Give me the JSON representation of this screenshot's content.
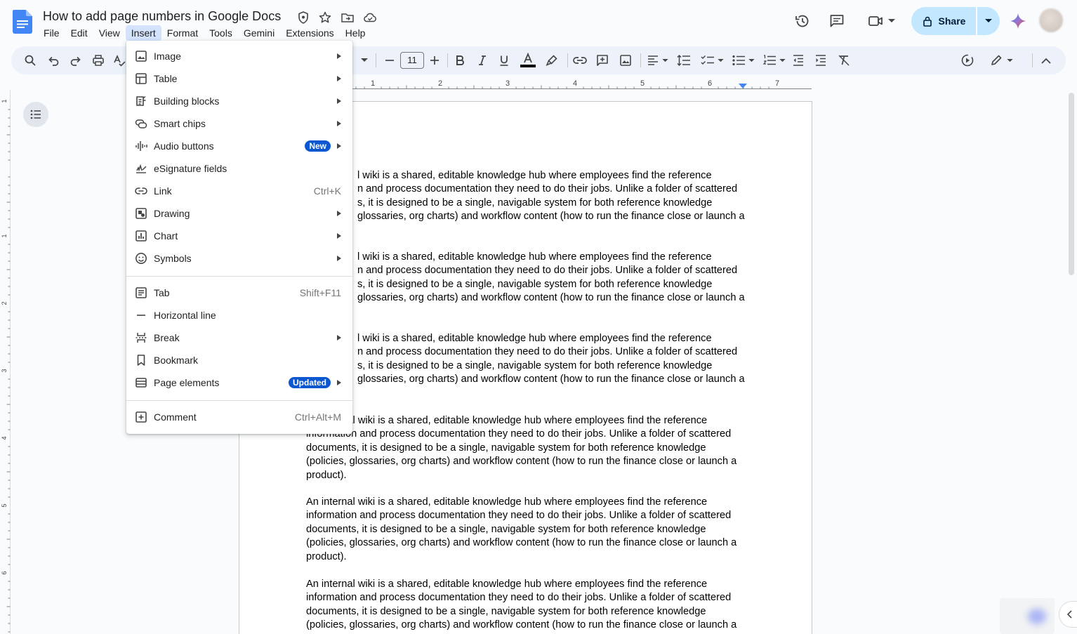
{
  "document": {
    "title": "How to add page numbers in Google Docs",
    "paragraph_first_lines": [
      "l wiki is a shared, editable knowledge hub where employees find the reference",
      "n and process documentation they need to do their jobs. Unlike a folder of scattered",
      "s, it is designed to be a single, navigable system for both reference knowledge",
      "glossaries, org charts) and workflow content (how to run the finance close or launch a"
    ],
    "paragraph_full_lines": [
      "An internal wiki is a shared, editable knowledge hub where employees find the reference",
      "information and process documentation they need to do their jobs. Unlike a folder of scattered",
      "documents, it is designed to be a single, navigable system for both reference knowledge",
      "(policies, glossaries, org charts) and workflow content (how to run the finance close or launch a",
      "product)."
    ]
  },
  "menubar": [
    "File",
    "Edit",
    "View",
    "Insert",
    "Format",
    "Tools",
    "Gemini",
    "Extensions",
    "Help"
  ],
  "header": {
    "share_label": "Share"
  },
  "toolbar": {
    "font_size": "11"
  },
  "ruler": {
    "labels": [
      "1",
      "2",
      "3",
      "4",
      "5",
      "6",
      "7"
    ],
    "vertical_labels": [
      "1",
      "1",
      "2",
      "3",
      "4",
      "5",
      "6"
    ]
  },
  "insert_menu": {
    "items": [
      {
        "label": "Image",
        "icon": "image-icon",
        "submenu": true
      },
      {
        "label": "Table",
        "icon": "table-icon",
        "submenu": true
      },
      {
        "label": "Building blocks",
        "icon": "building-blocks-icon",
        "submenu": true
      },
      {
        "label": "Smart chips",
        "icon": "smart-chips-icon",
        "submenu": true
      },
      {
        "label": "Audio buttons",
        "icon": "audio-icon",
        "submenu": true,
        "badge": "New"
      },
      {
        "label": "eSignature fields",
        "icon": "signature-icon",
        "submenu": false
      },
      {
        "label": "Link",
        "icon": "link-icon",
        "shortcut": "Ctrl+K"
      },
      {
        "label": "Drawing",
        "icon": "drawing-icon",
        "submenu": true
      },
      {
        "label": "Chart",
        "icon": "chart-icon",
        "submenu": true
      },
      {
        "label": "Symbols",
        "icon": "symbols-icon",
        "submenu": true
      },
      {
        "label": "Tab",
        "icon": "tab-icon",
        "shortcut": "Shift+F11"
      },
      {
        "label": "Horizontal line",
        "icon": "horizontal-line-icon"
      },
      {
        "label": "Break",
        "icon": "break-icon",
        "submenu": true
      },
      {
        "label": "Bookmark",
        "icon": "bookmark-icon"
      },
      {
        "label": "Page elements",
        "icon": "page-elements-icon",
        "submenu": true,
        "badge": "Updated"
      },
      {
        "label": "Comment",
        "icon": "comment-icon",
        "shortcut": "Ctrl+Alt+M"
      }
    ]
  },
  "colors": {
    "accent": "#0b57d0",
    "share_bg": "#c2e7ff",
    "menu_active": "#d3e3fd",
    "toolbar_bg": "#edf2fa"
  }
}
